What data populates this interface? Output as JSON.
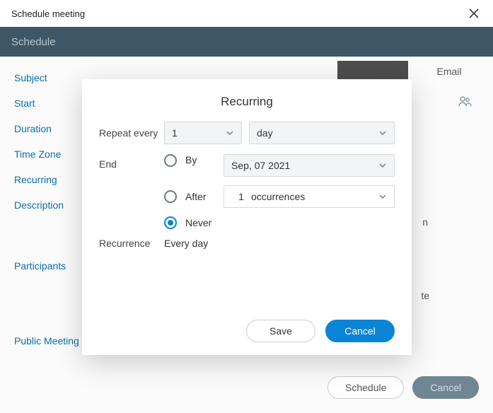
{
  "window": {
    "title": "Schedule meeting"
  },
  "toolbar": {
    "title": "Schedule"
  },
  "form": {
    "subject_label": "Subject",
    "start_label": "Start",
    "duration_label": "Duration",
    "timezone_label": "Time Zone",
    "recurring_label": "Recurring",
    "description_label": "Description",
    "participants_label": "Participants",
    "public_label": "Public Meeting",
    "email_btn": "Email",
    "schedule_btn": "Schedule",
    "cancel_btn": "Cancel",
    "peek_text": "te",
    "peek_text2": "n"
  },
  "modal": {
    "title": "Recurring",
    "repeat_label": "Repeat every",
    "repeat_count": "1",
    "repeat_unit": "day",
    "end_label": "End",
    "end_options": {
      "by_label": "By",
      "by_date": "Sep, 07 2021",
      "after_label": "After",
      "after_count": "1",
      "after_unit": "occurrences",
      "never_label": "Never",
      "selected": "never"
    },
    "recurrence_label": "Recurrence",
    "recurrence_value": "Every day",
    "save_btn": "Save",
    "cancel_btn": "Cancel"
  },
  "colors": {
    "accent": "#0a84d6",
    "toolbar": "#3d5766"
  }
}
